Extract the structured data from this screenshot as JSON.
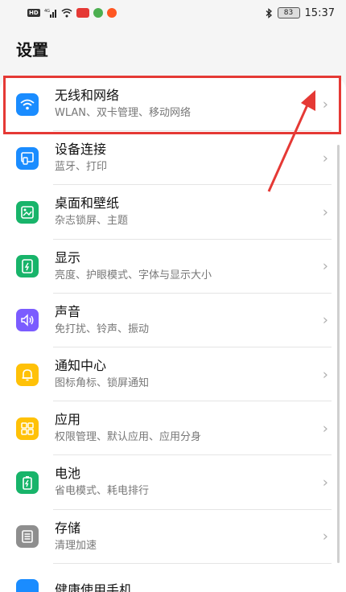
{
  "status_bar": {
    "hd": "HD",
    "net": "4G",
    "battery": "83",
    "time": "15:37"
  },
  "page": {
    "title": "设置"
  },
  "colors": {
    "accent_red": "#e53935",
    "wlan": "#1a8cff",
    "device": "#1a8cff",
    "wallpaper": "#18b46a",
    "display": "#18b46a",
    "sound": "#7b5cff",
    "notify": "#ffc107",
    "apps": "#ffc107",
    "battery": "#18b46a",
    "storage": "#8e8e8e"
  },
  "settings": {
    "items": [
      {
        "icon": "wifi-icon",
        "title": "无线和网络",
        "subtitle": "WLAN、双卡管理、移动网络"
      },
      {
        "icon": "device-connect-icon",
        "title": "设备连接",
        "subtitle": "蓝牙、打印"
      },
      {
        "icon": "wallpaper-icon",
        "title": "桌面和壁纸",
        "subtitle": "杂志锁屏、主题"
      },
      {
        "icon": "display-icon",
        "title": "显示",
        "subtitle": "亮度、护眼模式、字体与显示大小"
      },
      {
        "icon": "sound-icon",
        "title": "声音",
        "subtitle": "免打扰、铃声、振动"
      },
      {
        "icon": "notification-bell-icon",
        "title": "通知中心",
        "subtitle": "图标角标、锁屏通知"
      },
      {
        "icon": "apps-grid-icon",
        "title": "应用",
        "subtitle": "权限管理、默认应用、应用分身"
      },
      {
        "icon": "battery-icon",
        "title": "电池",
        "subtitle": "省电模式、耗电排行"
      },
      {
        "icon": "storage-icon",
        "title": "存储",
        "subtitle": "清理加速"
      },
      {
        "icon": "health-icon",
        "title": "健康使用手机",
        "subtitle": ""
      }
    ]
  }
}
